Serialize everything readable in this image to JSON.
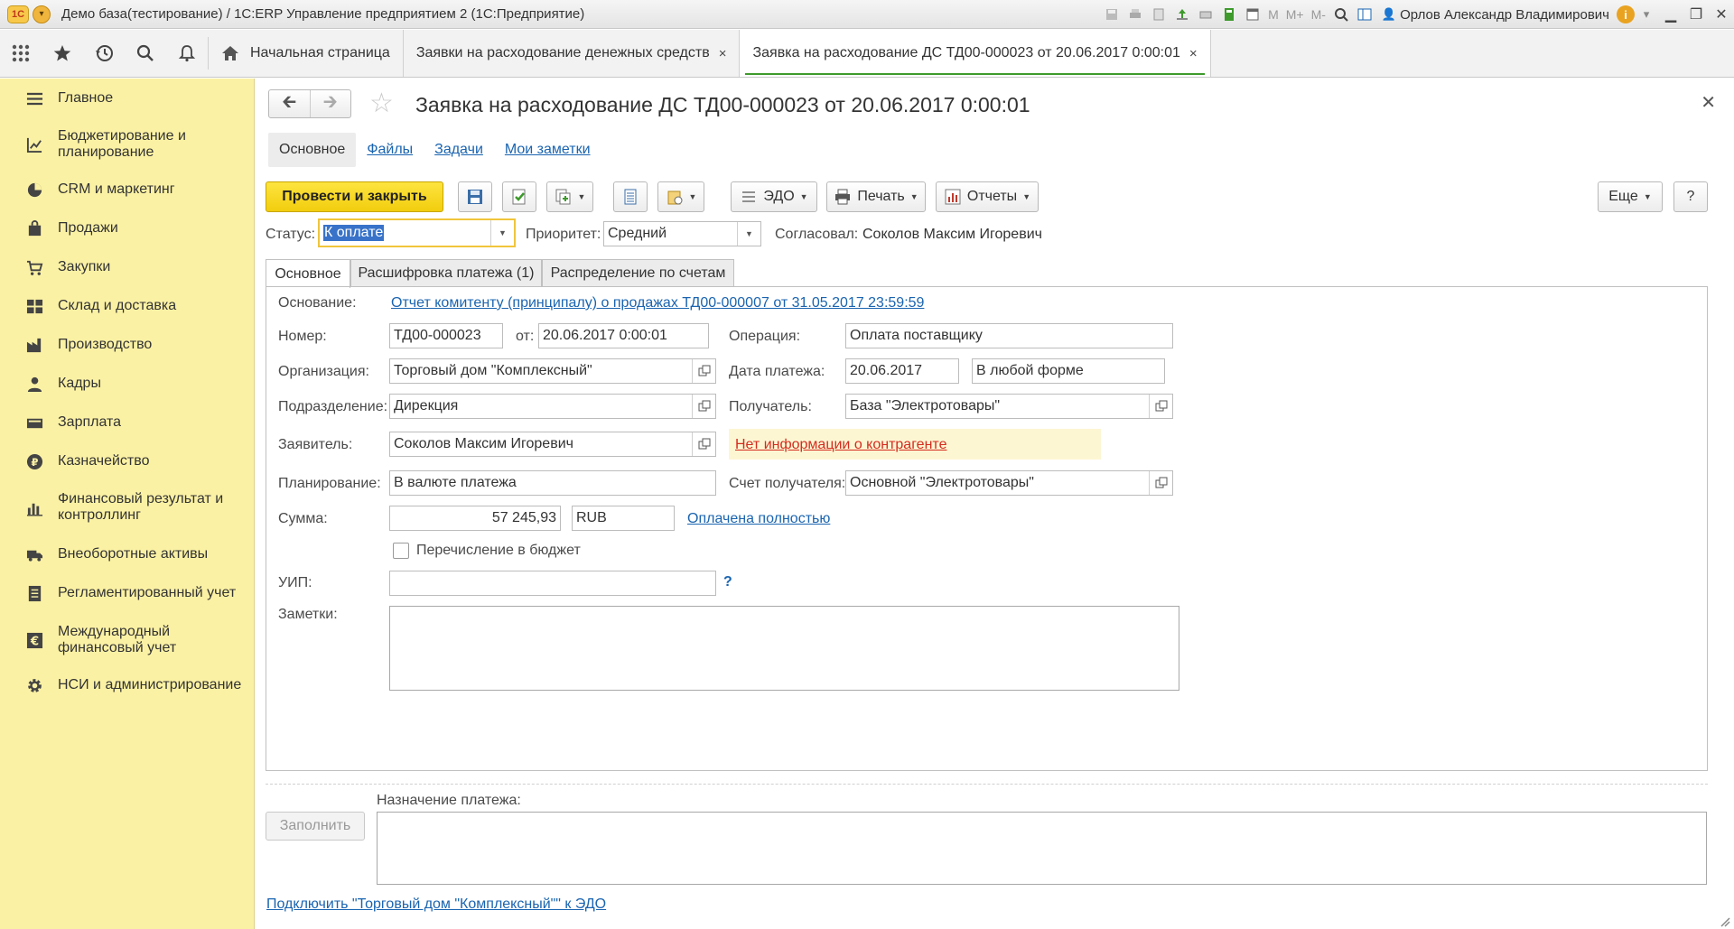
{
  "window": {
    "title": "Демо база(тестирование) / 1С:ERP Управление предприятием 2  (1С:Предприятие)",
    "logo": "1С",
    "memory_labels": [
      "M",
      "M+",
      "M-"
    ],
    "user": "Орлов Александр Владимирович"
  },
  "tabbar": {
    "tabs": [
      {
        "label": "Начальная страница"
      },
      {
        "label": "Заявки на расходование денежных средств"
      },
      {
        "label": "Заявка на расходование ДС ТД00-000023 от 20.06.2017 0:00:01"
      }
    ],
    "close_glyph": "×"
  },
  "sidebar": {
    "items": [
      {
        "label": "Главное",
        "icon": "menu-lines-icon"
      },
      {
        "label": "Бюджетирование и планирование",
        "icon": "budget-icon"
      },
      {
        "label": "CRM и маркетинг",
        "icon": "pie-icon"
      },
      {
        "label": "Продажи",
        "icon": "bag-icon"
      },
      {
        "label": "Закупки",
        "icon": "cart-icon"
      },
      {
        "label": "Склад и доставка",
        "icon": "warehouse-icon"
      },
      {
        "label": "Производство",
        "icon": "factory-icon"
      },
      {
        "label": "Кадры",
        "icon": "person-icon"
      },
      {
        "label": "Зарплата",
        "icon": "wallet-icon"
      },
      {
        "label": "Казначейство",
        "icon": "ruble-icon"
      },
      {
        "label": "Финансовый результат и контроллинг",
        "icon": "bar-chart-icon"
      },
      {
        "label": "Внеоборотные активы",
        "icon": "truck-icon"
      },
      {
        "label": "Регламентированный учет",
        "icon": "document-icon"
      },
      {
        "label": "Международный финансовый учет",
        "icon": "euro-icon"
      },
      {
        "label": "НСИ и администрирование",
        "icon": "gear-icon"
      }
    ]
  },
  "document": {
    "title": "Заявка на расходование ДС ТД00-000023 от 20.06.2017 0:00:01",
    "subtabs": [
      "Основное",
      "Файлы",
      "Задачи",
      "Мои заметки"
    ],
    "toolbar": {
      "post_close": "Провести и закрыть",
      "edo": "ЭДО",
      "print": "Печать",
      "reports": "Отчеты",
      "more": "Еще",
      "help": "?"
    },
    "status": {
      "status_label": "Статус:",
      "status_value": "К оплате",
      "priority_label": "Приоритет:",
      "priority_value": "Средний",
      "approved_label": "Согласовал:",
      "approved_value": "Соколов Максим Игоревич"
    },
    "form_tabs": [
      "Основное",
      "Расшифровка платежа (1)",
      "Распределение по счетам"
    ],
    "fields": {
      "basis_label": "Основание:",
      "basis_value": "Отчет комитенту (принципалу) о продажах ТД00-000007 от 31.05.2017 23:59:59",
      "number_label": "Номер:",
      "number_value": "ТД00-000023",
      "from_label": "от:",
      "from_value": "20.06.2017  0:00:01",
      "operation_label": "Операция:",
      "operation_value": "Оплата поставщику",
      "org_label": "Организация:",
      "org_value": "Торговый дом \"Комплексный\"",
      "paydate_label": "Дата платежа:",
      "paydate_value": "20.06.2017",
      "payform_value": "В любой форме",
      "dept_label": "Подразделение:",
      "dept_value": "Дирекция",
      "recipient_label": "Получатель:",
      "recipient_value": "База \"Электротовары\"",
      "applicant_label": "Заявитель:",
      "applicant_value": "Соколов Максим Игоревич",
      "no_info": "Нет информации о контрагенте",
      "planning_label": "Планирование:",
      "planning_value": "В валюте платежа",
      "account_label": "Счет получателя:",
      "account_value": "Основной \"Электротовары\"",
      "sum_label": "Сумма:",
      "sum_value": "57 245,93",
      "currency_value": "RUB",
      "paid_link": "Оплачена полностью",
      "budget_checkbox": "Перечисление в бюджет",
      "uip_label": "УИП:",
      "uip_value": "",
      "uip_help": "?",
      "notes_label": "Заметки:"
    },
    "purpose_label": "Назначение платежа:",
    "fill_button": "Заполнить",
    "edo_link": "Подключить \"Торговый дом \"Комплексный\"\" к ЭДО"
  }
}
